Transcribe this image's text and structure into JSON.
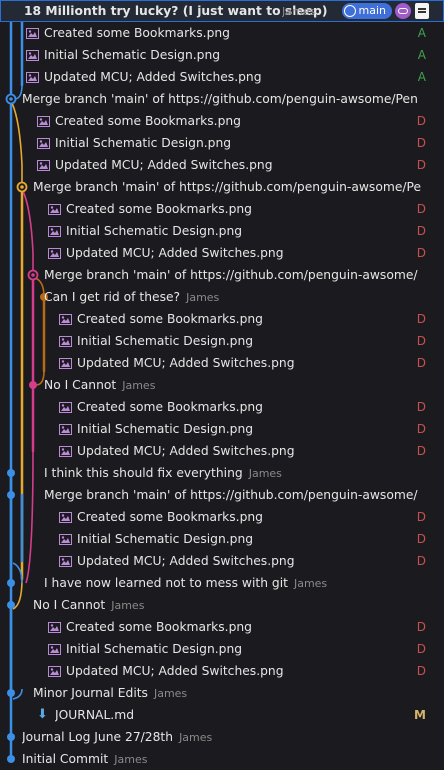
{
  "header": {
    "title": "18 Millionth try lucky? (I just want to sleep)",
    "author": "James",
    "badges": {
      "branch": "main",
      "cloud": "cloud-icon",
      "doc": "document-icon"
    }
  },
  "colors": {
    "blue": "#3b8fe6",
    "yellow": "#e7a92d",
    "pink": "#d63c8c",
    "orange": "#b96a14",
    "bg": "#1b1b1f",
    "select": "#2a6fd8"
  },
  "rows": [
    {
      "type": "file",
      "label": "Created some Bookmarks.png",
      "status": "A",
      "depth": 1
    },
    {
      "type": "file",
      "label": "Initial Schematic Design.png",
      "status": "A",
      "depth": 1
    },
    {
      "type": "file",
      "label": "Updated MCU;  Added Switches.png",
      "status": "A",
      "depth": 1
    },
    {
      "type": "commit",
      "label": "Merge branch 'main' of https://github.com/penguin-awsome/Pen",
      "author": "",
      "depth": 1
    },
    {
      "type": "file",
      "label": "Created some Bookmarks.png",
      "status": "D",
      "depth": 2
    },
    {
      "type": "file",
      "label": "Initial Schematic Design.png",
      "status": "D",
      "depth": 2
    },
    {
      "type": "file",
      "label": "Updated MCU;  Added Switches.png",
      "status": "D",
      "depth": 2
    },
    {
      "type": "commit",
      "label": "Merge branch 'main' of https://github.com/penguin-awsome/Pe",
      "author": "",
      "depth": 2
    },
    {
      "type": "file",
      "label": "Created some Bookmarks.png",
      "status": "D",
      "depth": 3
    },
    {
      "type": "file",
      "label": "Initial Schematic Design.png",
      "status": "D",
      "depth": 3
    },
    {
      "type": "file",
      "label": "Updated MCU;  Added Switches.png",
      "status": "D",
      "depth": 3
    },
    {
      "type": "commit",
      "label": "Merge branch 'main' of https://github.com/penguin-awsome/",
      "author": "",
      "depth": 3
    },
    {
      "type": "commit",
      "label": "Can I get rid of these?",
      "author": "James",
      "depth": 3
    },
    {
      "type": "file",
      "label": "Created some Bookmarks.png",
      "status": "D",
      "depth": 4
    },
    {
      "type": "file",
      "label": "Initial Schematic Design.png",
      "status": "D",
      "depth": 4
    },
    {
      "type": "file",
      "label": "Updated MCU;  Added Switches.png",
      "status": "D",
      "depth": 4
    },
    {
      "type": "commit",
      "label": "No I Cannot",
      "author": "James",
      "depth": 3
    },
    {
      "type": "file",
      "label": "Created some Bookmarks.png",
      "status": "D",
      "depth": 4
    },
    {
      "type": "file",
      "label": "Initial Schematic Design.png",
      "status": "D",
      "depth": 4
    },
    {
      "type": "file",
      "label": "Updated MCU;  Added Switches.png",
      "status": "D",
      "depth": 4
    },
    {
      "type": "commit",
      "label": "I think this should fix everything",
      "author": "James",
      "depth": 3
    },
    {
      "type": "commit",
      "label": "Merge branch 'main' of https://github.com/penguin-awsome/",
      "author": "",
      "depth": 3
    },
    {
      "type": "file",
      "label": "Created some Bookmarks.png",
      "status": "D",
      "depth": 4
    },
    {
      "type": "file",
      "label": "Initial Schematic Design.png",
      "status": "D",
      "depth": 4
    },
    {
      "type": "file",
      "label": "Updated MCU;  Added Switches.png",
      "status": "D",
      "depth": 4
    },
    {
      "type": "commit",
      "label": "I have now learned not to mess with git",
      "author": "James",
      "depth": 3
    },
    {
      "type": "commit",
      "label": "No I Cannot",
      "author": "James",
      "depth": 2
    },
    {
      "type": "file",
      "label": "Created some Bookmarks.png",
      "status": "D",
      "depth": 3
    },
    {
      "type": "file",
      "label": "Initial Schematic Design.png",
      "status": "D",
      "depth": 3
    },
    {
      "type": "file",
      "label": "Updated MCU;  Added Switches.png",
      "status": "D",
      "depth": 3
    },
    {
      "type": "commit",
      "label": "Minor Journal Edits",
      "author": "James",
      "depth": 2
    },
    {
      "type": "mdfile",
      "label": "JOURNAL.md",
      "status": "M",
      "depth": 2
    },
    {
      "type": "commit",
      "label": "Journal Log June 27/28th",
      "author": "James",
      "depth": 1
    },
    {
      "type": "commit",
      "label": "Initial Commit",
      "author": "James",
      "depth": 1
    }
  ]
}
